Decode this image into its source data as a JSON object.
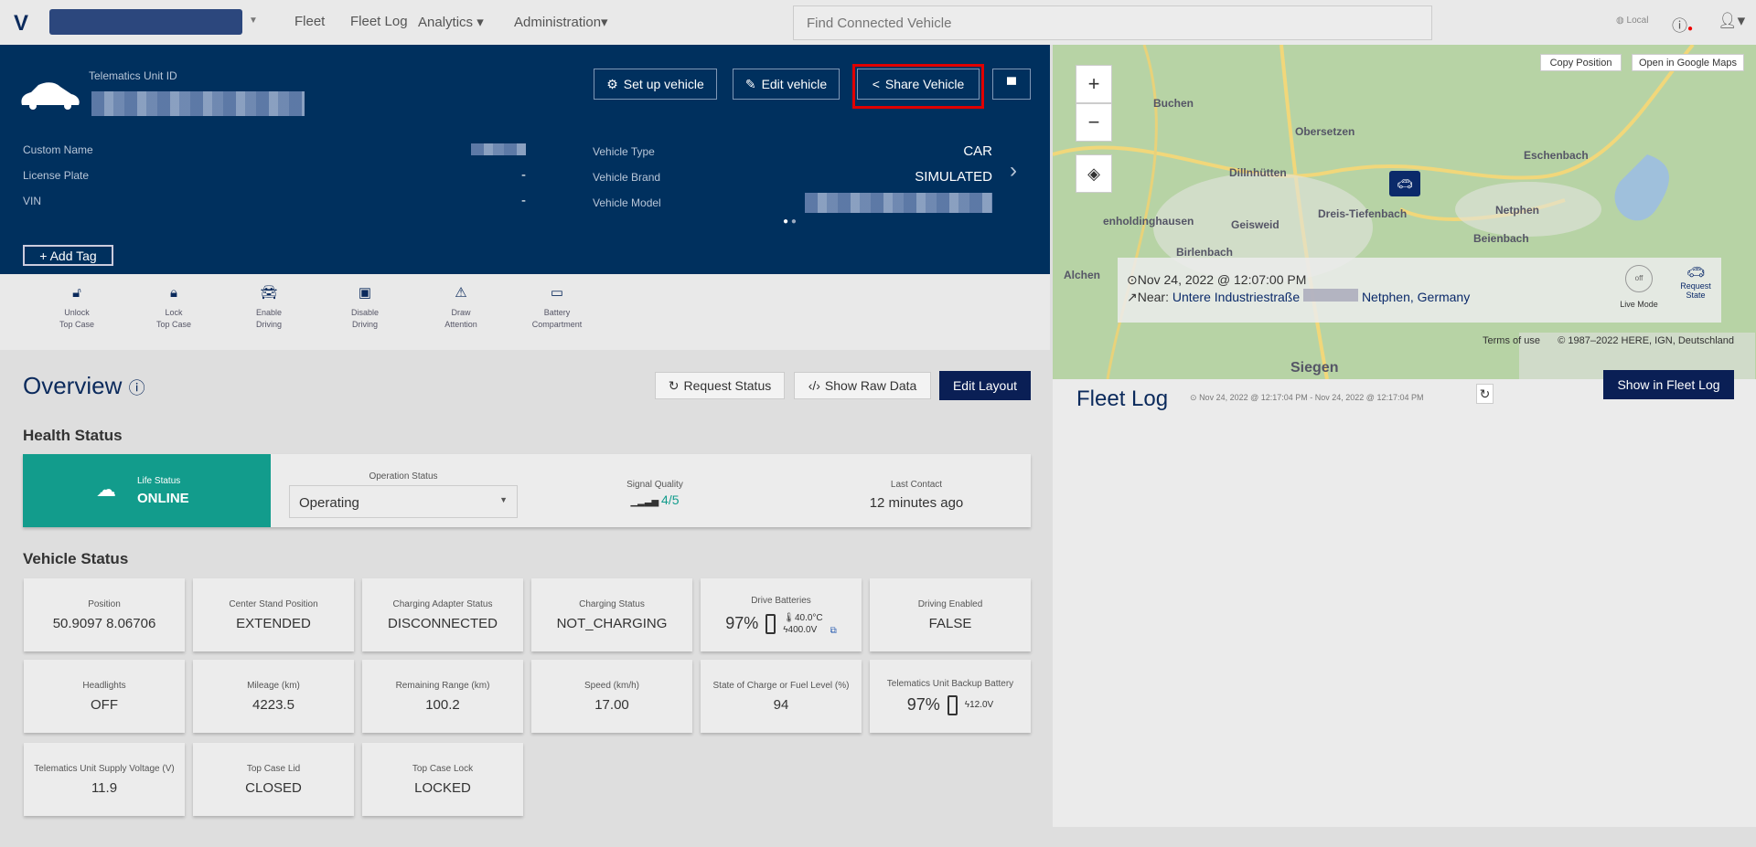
{
  "nav": {
    "links": [
      "Fleet",
      "Fleet Log",
      "Analytics",
      "Administration"
    ],
    "search_placeholder": "Find Connected Vehicle",
    "locale": "Local"
  },
  "vehicle": {
    "unit_id_label": "Telematics Unit ID",
    "buttons": {
      "setup": "Set up vehicle",
      "edit": "Edit vehicle",
      "share": "Share Vehicle"
    },
    "fields_left": [
      {
        "label": "Custom Name",
        "value": ""
      },
      {
        "label": "License Plate",
        "value": "-"
      },
      {
        "label": "VIN",
        "value": "-"
      }
    ],
    "fields_right": [
      {
        "label": "Vehicle Type",
        "value": "CAR"
      },
      {
        "label": "Vehicle Brand",
        "value": "SIMULATED"
      },
      {
        "label": "Vehicle Model",
        "value": ""
      }
    ],
    "add_tag": "Add Tag",
    "highlight_color": "#e00000"
  },
  "actions": [
    {
      "l1": "Unlock",
      "l2": "Top Case",
      "icon": "unlock-icon"
    },
    {
      "l1": "Lock",
      "l2": "Top Case",
      "icon": "lock-icon"
    },
    {
      "l1": "Enable",
      "l2": "Driving",
      "icon": "car-icon"
    },
    {
      "l1": "Disable",
      "l2": "Driving",
      "icon": "disable-icon"
    },
    {
      "l1": "Draw",
      "l2": "Attention",
      "icon": "warning-icon"
    },
    {
      "l1": "Battery",
      "l2": "Compartment",
      "icon": "battery-icon"
    }
  ],
  "overview": {
    "title": "Overview",
    "request_status": "Request Status",
    "show_raw": "Show Raw Data",
    "edit_layout": "Edit Layout"
  },
  "health": {
    "title": "Health Status",
    "life_label": "Life Status",
    "life_value": "ONLINE",
    "op_label": "Operation Status",
    "op_value": "Operating",
    "signal_label": "Signal Quality",
    "signal_value": "4/5",
    "contact_label": "Last Contact",
    "contact_value": "12 minutes ago",
    "accent": "#129c8c"
  },
  "vstatus": {
    "title": "Vehicle Status",
    "cards": [
      {
        "t": "Position",
        "v": "50.9097 8.06706"
      },
      {
        "t": "Center Stand Position",
        "v": "EXTENDED"
      },
      {
        "t": "Charging Adapter Status",
        "v": "DISCONNECTED"
      },
      {
        "t": "Charging Status",
        "v": "NOT_CHARGING"
      },
      {
        "t": "Drive Batteries",
        "v": "97%",
        "temp": "40.0°C",
        "volt": "400.0V"
      },
      {
        "t": "Driving Enabled",
        "v": "FALSE"
      },
      {
        "t": "Headlights",
        "v": "OFF"
      },
      {
        "t": "Mileage (km)",
        "v": "4223.5"
      },
      {
        "t": "Remaining Range (km)",
        "v": "100.2"
      },
      {
        "t": "Speed (km/h)",
        "v": "17.00"
      },
      {
        "t": "State of Charge or Fuel Level (%)",
        "v": "94"
      },
      {
        "t": "Telematics Unit Backup Battery",
        "v": "97%",
        "volt": "12.0V"
      },
      {
        "t": "Telematics Unit Supply Voltage (V)",
        "v": "11.9"
      },
      {
        "t": "Top Case Lid",
        "v": "CLOSED"
      },
      {
        "t": "Top Case Lock",
        "v": "LOCKED"
      }
    ]
  },
  "map": {
    "copy": "Copy Position",
    "google": "Open in Google Maps",
    "towns": [
      "Buchen",
      "Obersetzen",
      "Eschenbach",
      "Dillnhütten",
      "Dreis-Tiefenbach",
      "Netphen",
      "Geisweid",
      "Birlenbach",
      "Alchen",
      "Beienbach",
      "Siegen",
      "enholdinghausen"
    ],
    "time": "Nov 24, 2022 @ 12:07:00 PM",
    "near": "Near:",
    "street": "Untere Industriestraße",
    "city": "Netphen, Germany",
    "live_off": "off",
    "live": "Live Mode",
    "request_state": "Request State",
    "terms": "Terms of use",
    "copyright": "© 1987–2022 HERE, IGN, Deutschland"
  },
  "fleetlog": {
    "title": "Fleet Log",
    "range": "Nov 24, 2022 @ 12:17:04 PM - Nov 24, 2022 @ 12:17:04 PM",
    "show": "Show in Fleet Log"
  }
}
